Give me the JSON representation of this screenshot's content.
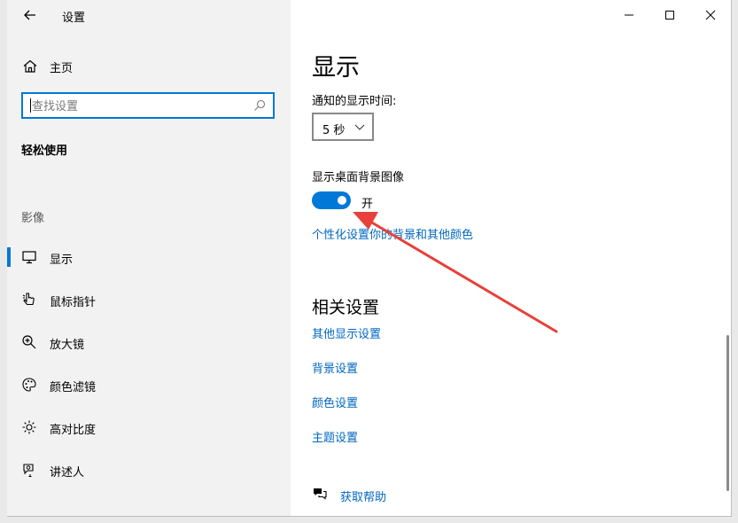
{
  "window": {
    "title": "设置"
  },
  "sidebar": {
    "home_label": "主页",
    "search_placeholder": "查找设置",
    "section_title": "轻松使用",
    "group_label": "影像",
    "items": [
      {
        "label": "显示",
        "icon": "monitor-icon",
        "active": true
      },
      {
        "label": "鼠标指针",
        "icon": "mouse-pointer-icon",
        "active": false
      },
      {
        "label": "放大镜",
        "icon": "magnifier-icon",
        "active": false
      },
      {
        "label": "颜色滤镜",
        "icon": "palette-icon",
        "active": false
      },
      {
        "label": "高对比度",
        "icon": "brightness-icon",
        "active": false
      },
      {
        "label": "讲述人",
        "icon": "narrator-icon",
        "active": false
      }
    ]
  },
  "main": {
    "page_title": "显示",
    "notification_time_label": "通知的显示时间:",
    "notification_time_value": "5 秒",
    "desktop_bg_label": "显示桌面背景图像",
    "toggle_state": "开",
    "personalize_link": "个性化设置你的背景和其他颜色",
    "related_title": "相关设置",
    "related_links": [
      "其他显示设置",
      "背景设置",
      "颜色设置",
      "主题设置"
    ],
    "help_link": "获取帮助"
  },
  "colors": {
    "accent": "#0078d7",
    "link": "#0067c0",
    "annotation_arrow": "#e8403a"
  }
}
